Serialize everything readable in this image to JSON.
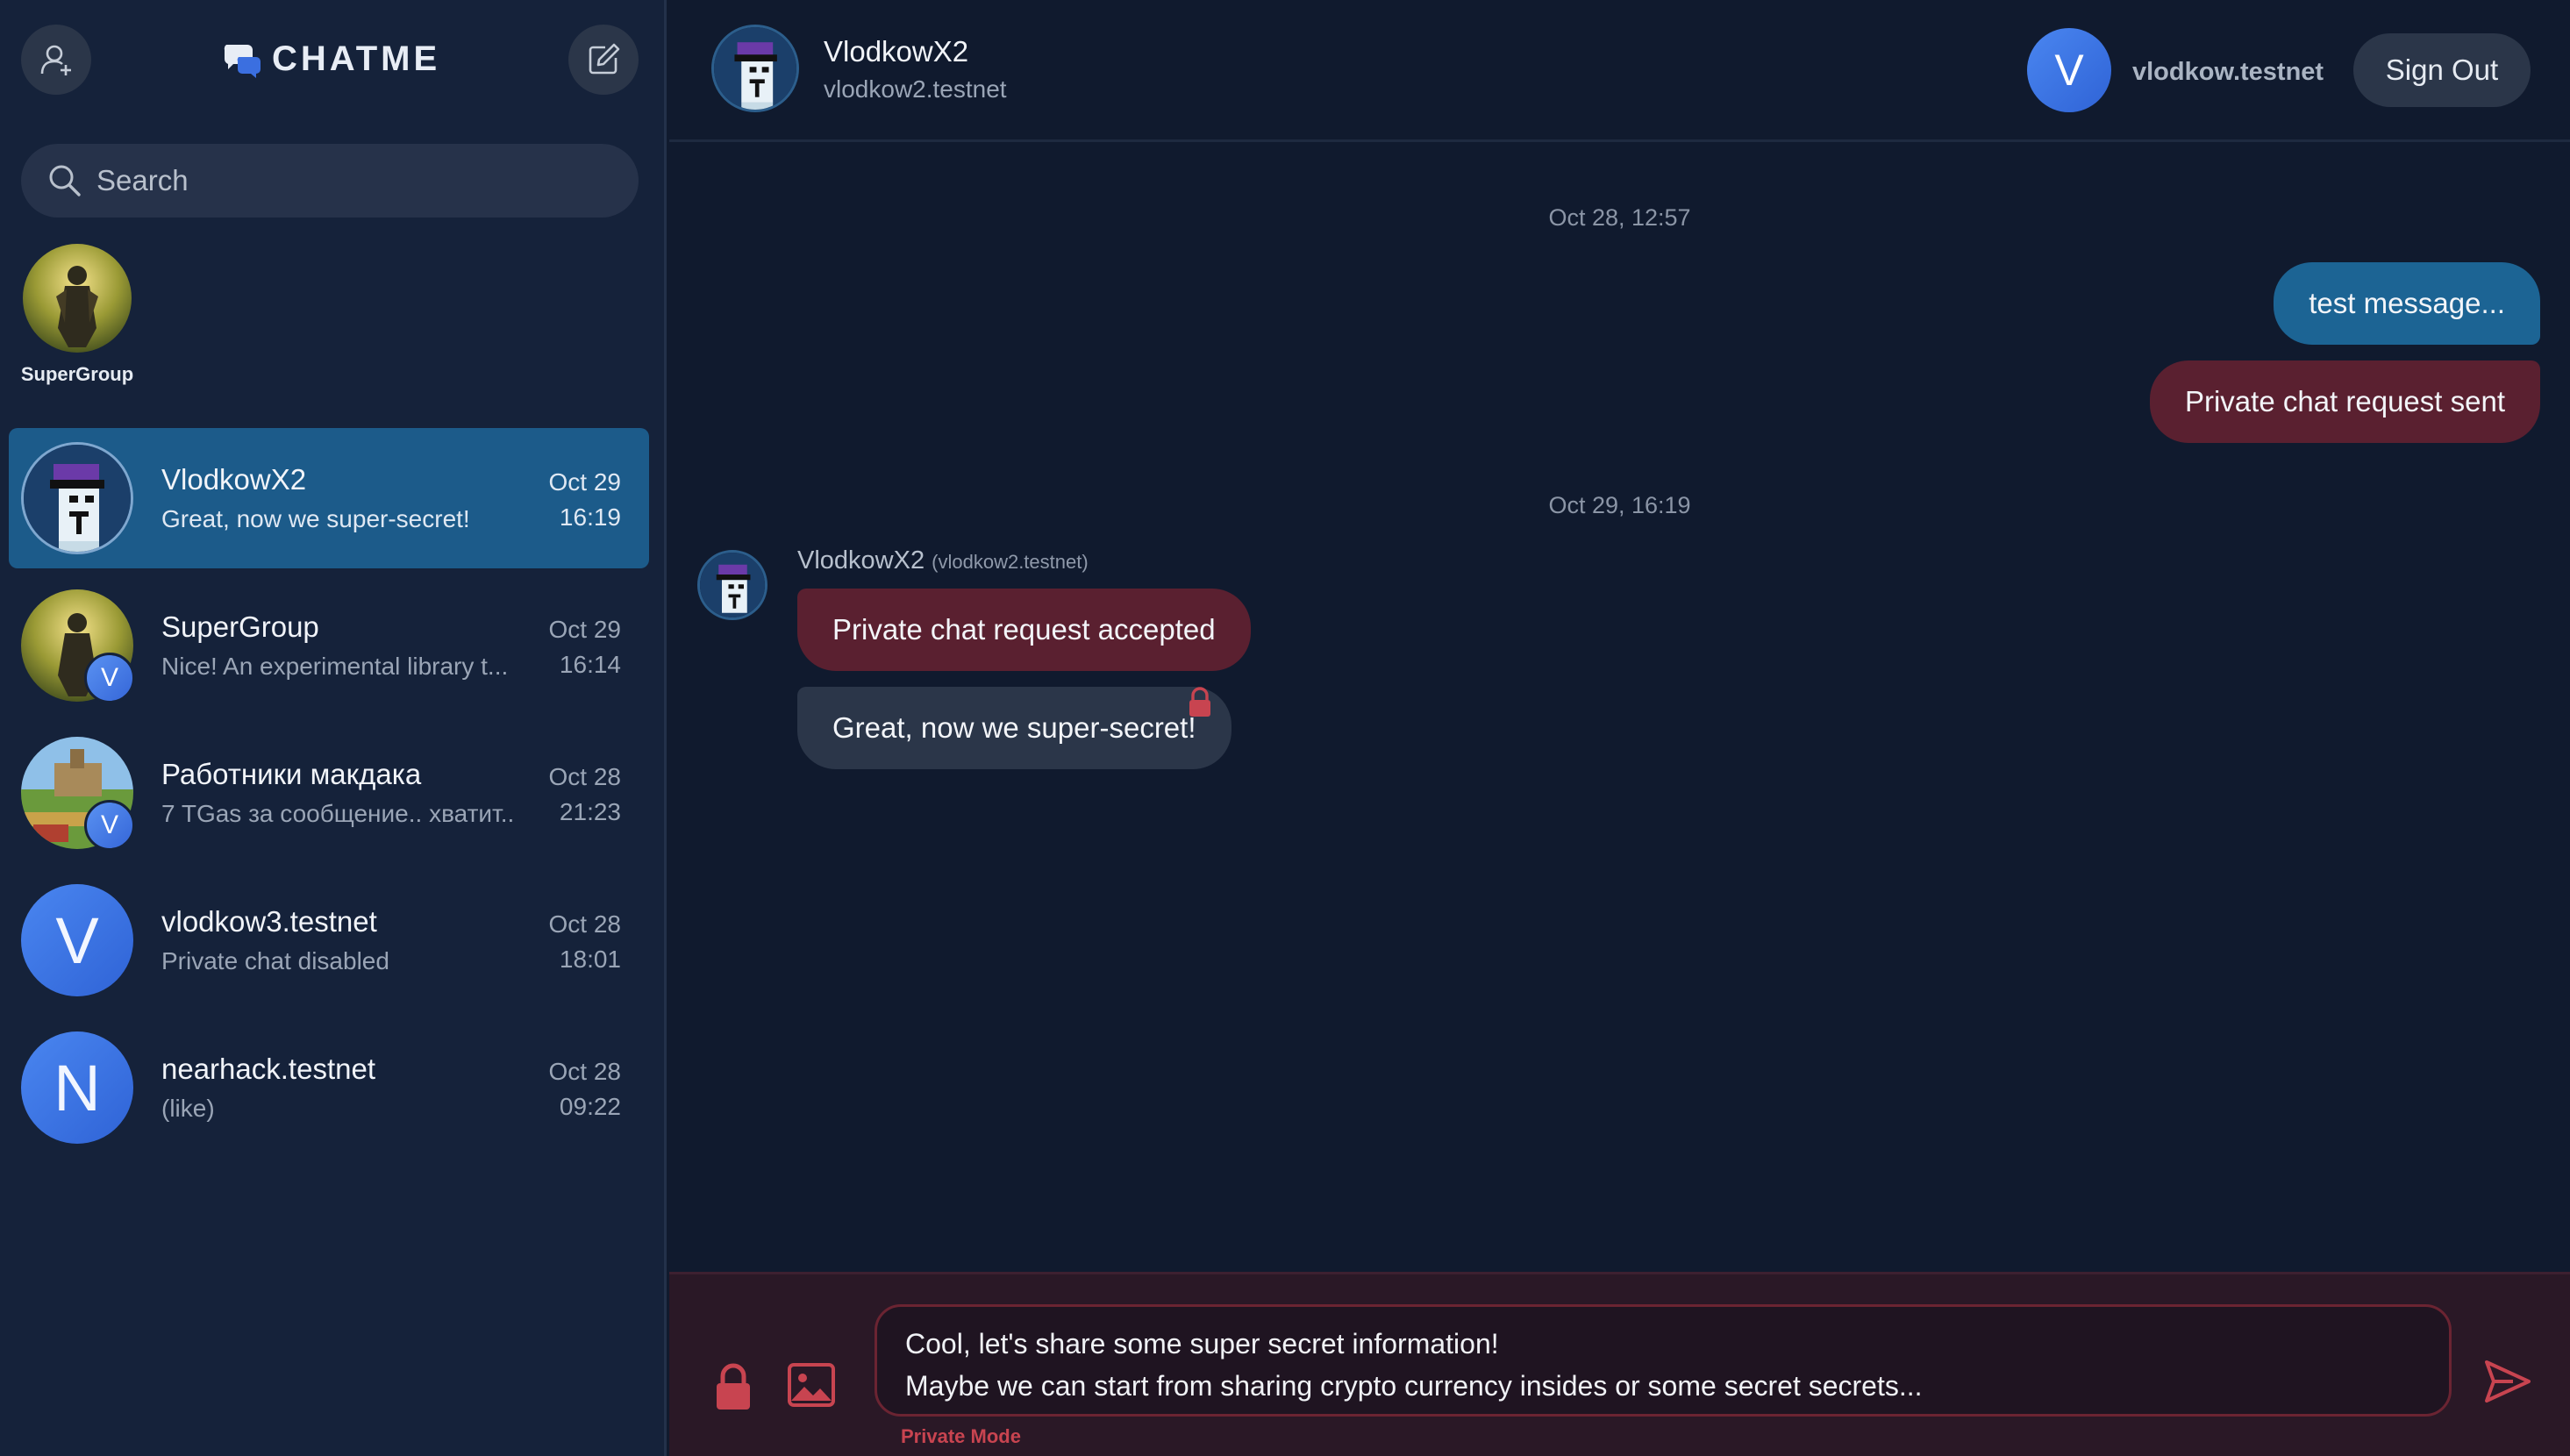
{
  "app": {
    "logo_text": "CHATME",
    "colors": {
      "background": "#101a2e",
      "sidebar": "#15223a",
      "accent_blue": "#1c6494",
      "private_red": "#5a2030",
      "private_mode": "#c84450"
    }
  },
  "sidebar": {
    "add_contact_icon": "user-plus-icon",
    "compose_icon": "edit-icon",
    "search": {
      "placeholder": "Search",
      "value": ""
    },
    "group_shortcut": {
      "label": "SuperGroup"
    },
    "chats": [
      {
        "name": "VlodkowX2",
        "preview": "Great, now we super-secret!",
        "date": "Oct 29",
        "time": "16:19",
        "active": true,
        "avatar": "pixel-punk"
      },
      {
        "name": "SuperGroup",
        "preview": "Nice! An experimental library t...",
        "date": "Oct 29",
        "time": "16:14",
        "badge": "V",
        "avatar": "knight"
      },
      {
        "name": "Работники макдака",
        "preview": "7 TGas за сообщение.. хватит...",
        "date": "Oct 28",
        "time": "21:23",
        "badge": "V",
        "avatar": "landscape"
      },
      {
        "name": "vlodkow3.testnet",
        "preview": "Private chat disabled",
        "date": "Oct 28",
        "time": "18:01",
        "letter": "V"
      },
      {
        "name": "nearhack.testnet",
        "preview": "(like)",
        "date": "Oct 28",
        "time": "09:22",
        "letter": "N"
      }
    ]
  },
  "header": {
    "contact_name": "VlodkowX2",
    "contact_account": "vlodkow2.testnet",
    "me_letter": "V",
    "me_account": "vlodkow.testnet",
    "signout_label": "Sign Out"
  },
  "messages": {
    "date_1": "Oct 28, 12:57",
    "out_1": "test message...",
    "out_2": "Private chat request sent",
    "date_2": "Oct 29, 16:19",
    "sender_name": "VlodkowX2",
    "sender_account": "(vlodkow2.testnet)",
    "in_1": "Private chat request accepted",
    "in_2": "Great, now we super-secret!"
  },
  "composer": {
    "value": "Cool, let's share some super secret information!\nMaybe we can start from sharing crypto currency insides or some secret secrets...",
    "mode_label": "Private Mode"
  }
}
